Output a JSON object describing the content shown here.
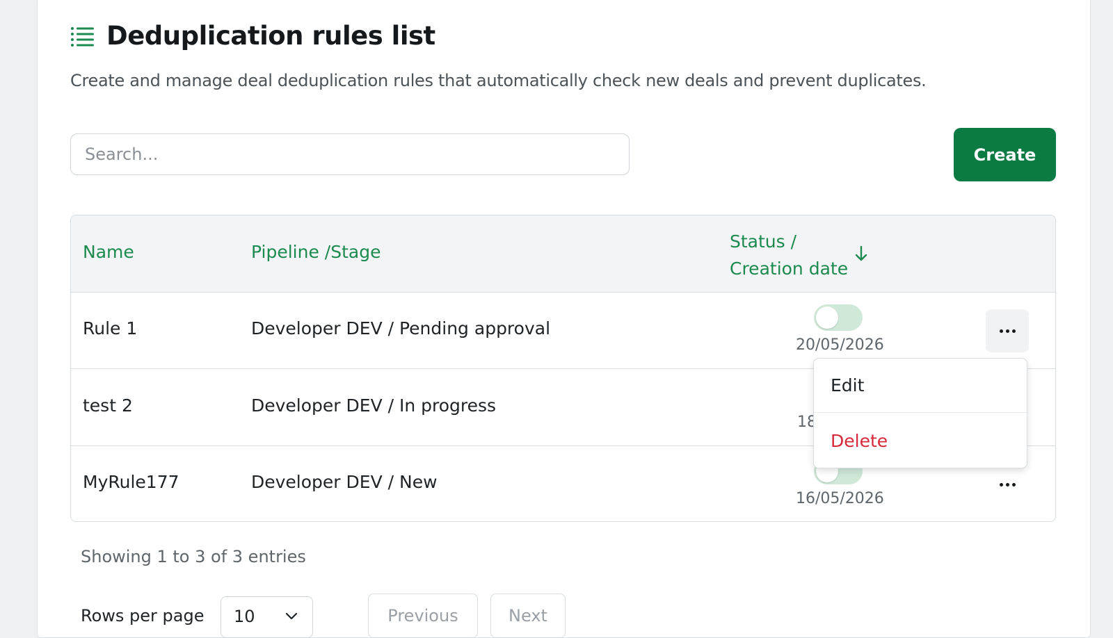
{
  "page": {
    "title": "Deduplication rules list",
    "subtitle": "Create and manage deal deduplication rules that automatically check new deals and prevent duplicates."
  },
  "search": {
    "placeholder": "Search..."
  },
  "create_label": "Create",
  "table": {
    "columns": [
      "Name",
      "Pipeline /Stage",
      "Status /",
      "Creation date"
    ],
    "sort": {
      "column": "Status / Creation date",
      "direction": "descending",
      "icon": "arrow-down-icon"
    },
    "rows": [
      {
        "name": "Rule 1",
        "pipeline": "Developer DEV / Pending approval",
        "enabled": false,
        "date": "20/05/2026"
      },
      {
        "name": "test 2",
        "pipeline": "Developer DEV / In progress",
        "enabled": false,
        "date": "18"
      },
      {
        "name": "MyRule177",
        "pipeline": "Developer DEV / New",
        "enabled": false,
        "date": "16/05/2026"
      }
    ]
  },
  "row_menu": {
    "open_for_row": "Rule 1",
    "edit_label": "Edit",
    "delete_label": "Delete"
  },
  "pagination": {
    "showing": "Showing 1 to 3 of 3 entries",
    "rows_per_page_label": "Rows per page",
    "rows_per_page_value": "10",
    "previous_label": "Previous",
    "next_label": "Next"
  },
  "colors": {
    "accent": "#0b7a43",
    "header_text": "#1b8a4e",
    "toggle_off": "#cfe8d8",
    "danger": "#d6283a"
  }
}
